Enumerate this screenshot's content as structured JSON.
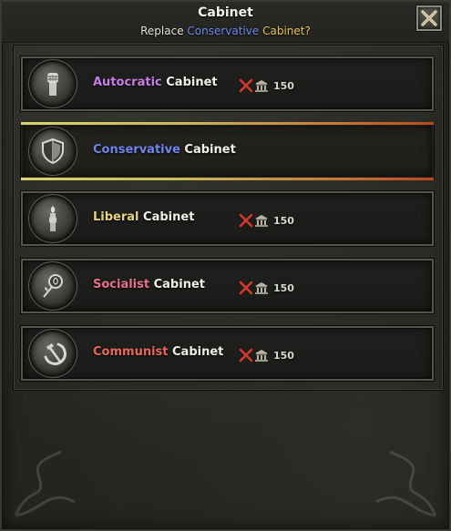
{
  "dialog": {
    "title": "Cabinet",
    "subtitle_prefix": "Replace ",
    "subtitle_ideology": "Conservative",
    "subtitle_space": " ",
    "subtitle_suffix": "Cabinet?",
    "close_icon": "close-x-icon"
  },
  "colors": {
    "autocratic": "#c77ee6",
    "conservative": "#6e86ef",
    "liberal": "#e6d47a",
    "socialist": "#e86e8c",
    "communist": "#e8675a",
    "subtitle_suffix": "#e7c64a",
    "cost_x": "#d23a2a"
  },
  "cabinets": [
    {
      "ideology": "Autocratic",
      "suffix": " Cabinet",
      "icon": "fist-icon",
      "cost": "150",
      "selected": false
    },
    {
      "ideology": "Conservative",
      "suffix": " Cabinet",
      "icon": "shield-icon",
      "cost": "",
      "selected": true
    },
    {
      "ideology": "Liberal",
      "suffix": " Cabinet",
      "icon": "torch-hand-icon",
      "cost": "150",
      "selected": false
    },
    {
      "ideology": "Socialist",
      "suffix": " Cabinet",
      "icon": "rose-icon",
      "cost": "150",
      "selected": false
    },
    {
      "ideology": "Communist",
      "suffix": " Cabinet",
      "icon": "hammer-sickle-icon",
      "cost": "150",
      "selected": false
    }
  ]
}
